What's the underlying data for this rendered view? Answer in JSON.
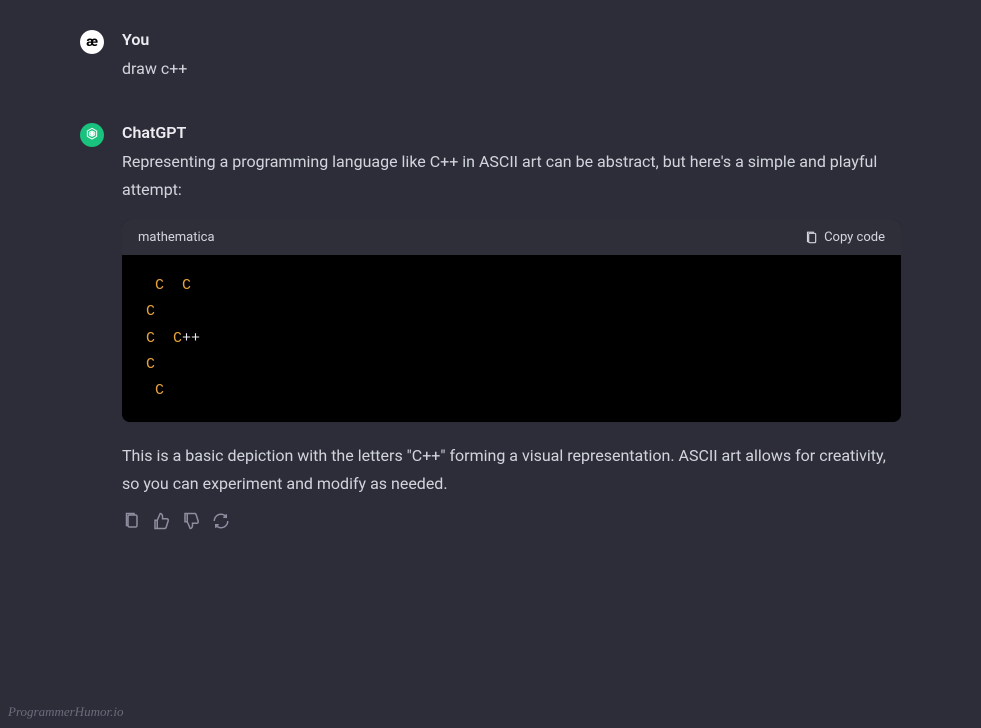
{
  "user": {
    "name": "You",
    "avatar_symbol": "æ",
    "message": "draw c++"
  },
  "assistant": {
    "name": "ChatGPT",
    "intro": "Representing a programming language like C++ in ASCII art can be abstract, but here's a simple and playful attempt:",
    "outro": "This is a basic depiction with the letters \"C++\" forming a visual representation. ASCII art allows for creativity, so you can experiment and modify as needed."
  },
  "code": {
    "language": "mathematica",
    "copy_label": "Copy code",
    "lines": [
      {
        "parts": [
          {
            "text": " C  C",
            "cls": "c-char"
          }
        ]
      },
      {
        "parts": [
          {
            "text": "C",
            "cls": "c-char"
          }
        ]
      },
      {
        "parts": [
          {
            "text": "C  C",
            "cls": "c-char"
          },
          {
            "text": "++",
            "cls": "plus"
          }
        ]
      },
      {
        "parts": [
          {
            "text": "C",
            "cls": "c-char"
          }
        ]
      },
      {
        "parts": [
          {
            "text": " C",
            "cls": "c-char"
          }
        ]
      }
    ]
  },
  "watermark": "ProgrammerHumor.io"
}
